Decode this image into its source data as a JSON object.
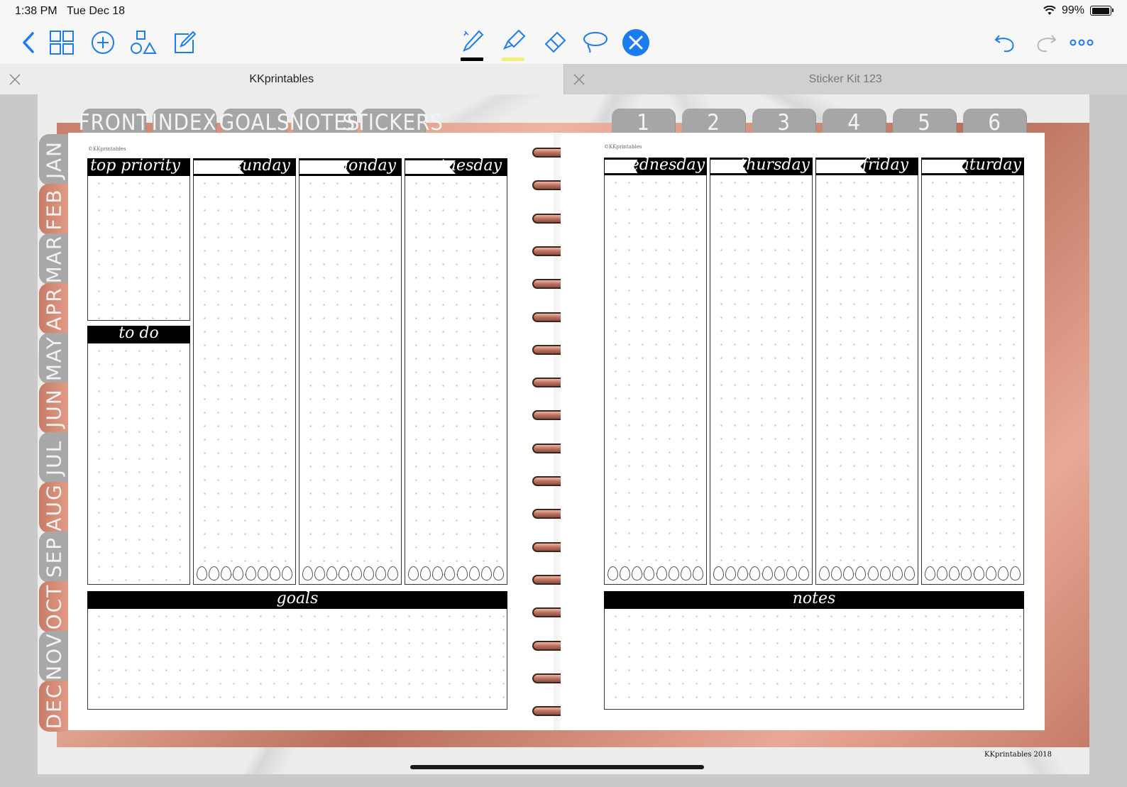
{
  "status_bar": {
    "time": "1:38 PM",
    "date": "Tue Dec 18",
    "battery": "99%",
    "battery_level": 0.99
  },
  "toolbar": {
    "left_icons": [
      "back-icon",
      "grid-icon",
      "add-icon",
      "shapes-icon",
      "edit-icon"
    ],
    "center_tools": [
      "pen-icon",
      "highlighter-icon",
      "eraser-icon",
      "lasso-icon",
      "close-tool-icon"
    ],
    "right_icons": [
      "undo-icon",
      "redo-icon",
      "more-icon"
    ],
    "pen_color": "#000000",
    "highlighter_color": "#f2f07a",
    "accent": "#1a7cf2"
  },
  "tabs": [
    {
      "title": "KKprintables",
      "active": true
    },
    {
      "title": "Sticker Kit 123",
      "active": false
    }
  ],
  "planner": {
    "top_tabs_left": [
      "FRONT",
      "INDEX",
      "GOALS",
      "NOTES",
      "STICKERS"
    ],
    "top_tabs_right": [
      "1",
      "2",
      "3",
      "4",
      "5",
      "6"
    ],
    "months": [
      "JAN",
      "FEB",
      "MAR",
      "APR",
      "MAY",
      "JUN",
      "JUL",
      "AUG",
      "SEP",
      "OCT",
      "NOV",
      "DEC"
    ],
    "watermark": "©KKprintables",
    "left_page": {
      "top_priority": "top priority",
      "to_do": "to do",
      "days": [
        "sunday",
        "monday",
        "tuesday"
      ],
      "goals": "goals"
    },
    "right_page": {
      "days": [
        "wednesday",
        "thursday",
        "friday",
        "saturday"
      ],
      "notes": "notes"
    },
    "credit": "KKprintables 2018",
    "colors": {
      "rose_gold": "#d58f7a",
      "tab_grey": "#a6a6a6"
    }
  }
}
